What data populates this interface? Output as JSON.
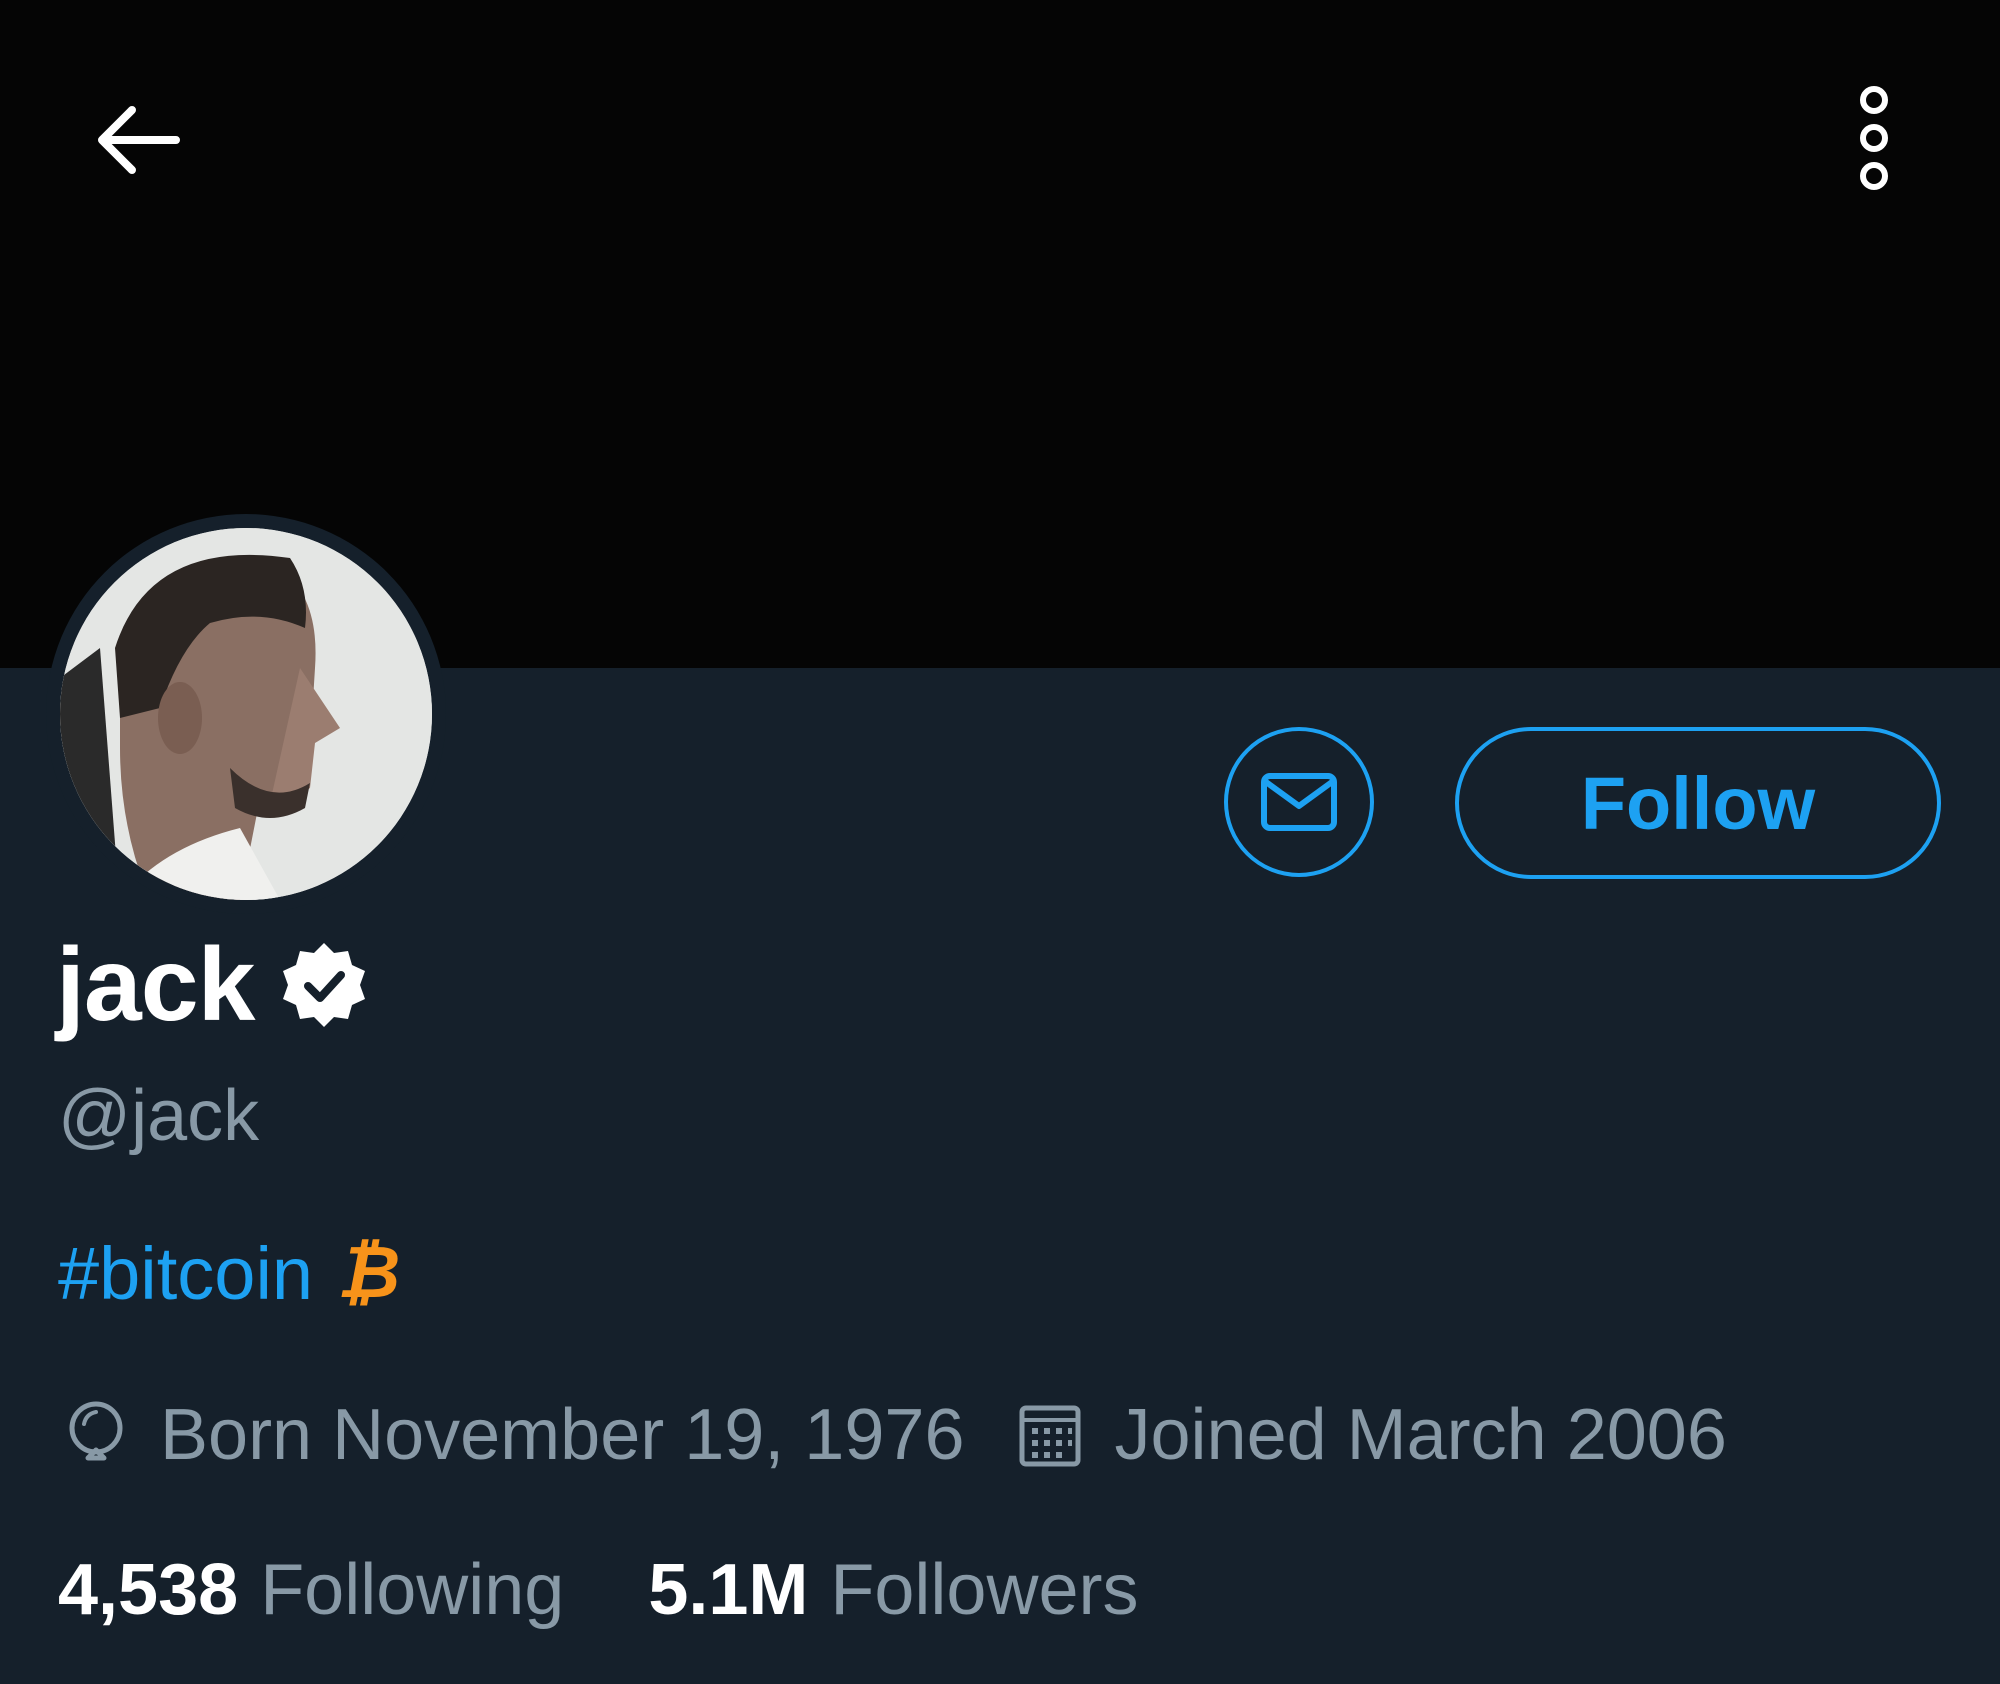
{
  "header": {
    "back_icon": "arrow-left-icon",
    "more_icon": "more-vertical-icon"
  },
  "profile": {
    "display_name": "jack",
    "verified_icon": "verified-badge-icon",
    "handle": "@jack",
    "bio_hashtag": "#bitcoin",
    "bio_emoji": "₿",
    "birth_icon": "balloon-icon",
    "born": "Born November 19, 1976",
    "calendar_icon": "calendar-icon",
    "joined": "Joined March 2006"
  },
  "actions": {
    "message_icon": "envelope-icon",
    "follow_label": "Follow"
  },
  "stats": {
    "following_count": "4,538",
    "following_label": "Following",
    "followers_count": "5.1M",
    "followers_label": "Followers"
  },
  "colors": {
    "background": "#15202b",
    "banner": "#050505",
    "accent": "#1da1f2",
    "secondary_text": "#8899a6",
    "bitcoin": "#f7931a"
  }
}
